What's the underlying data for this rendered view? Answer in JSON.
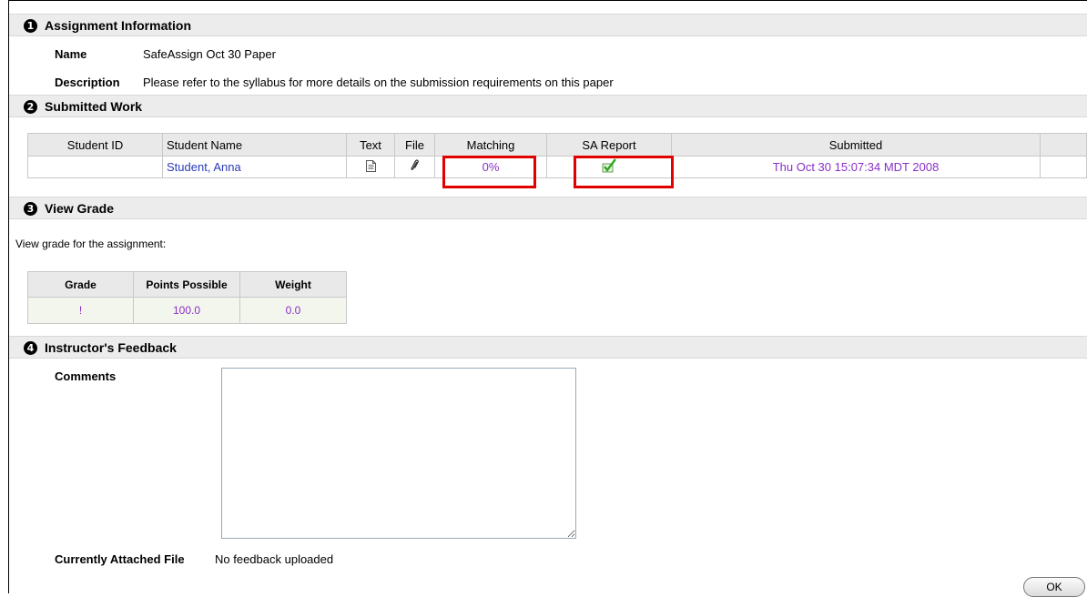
{
  "sections": {
    "assignment": {
      "number": "1",
      "title": "Assignment Information",
      "name_label": "Name",
      "name_value": "SafeAssign Oct 30 Paper",
      "description_label": "Description",
      "description_value": "Please refer to the syllabus for more details on the submission requirements on this paper"
    },
    "submitted": {
      "number": "2",
      "title": "Submitted Work",
      "columns": [
        "Student ID",
        "Student Name",
        "Text",
        "File",
        "Matching",
        "SA Report",
        "Submitted",
        ""
      ],
      "row": {
        "student_id": "",
        "student_name": "Student, Anna",
        "text_icon": "document-icon",
        "file_icon": "paperclip-icon",
        "matching": "0%",
        "sa_report_icon": "green-checkmark-icon",
        "submitted": "Thu Oct 30 15:07:34 MDT 2008"
      }
    },
    "grade": {
      "number": "3",
      "title": "View Grade",
      "intro": "View grade for the assignment:",
      "columns": [
        "Grade",
        "Points Possible",
        "Weight"
      ],
      "values": [
        "!",
        "100.0",
        "0.0"
      ]
    },
    "feedback": {
      "number": "4",
      "title": "Instructor's Feedback",
      "comments_label": "Comments",
      "comments_value": "",
      "attached_label": "Currently Attached File",
      "attached_value": "No feedback uploaded"
    }
  },
  "buttons": {
    "ok_label": "OK"
  },
  "colors": {
    "link": "#2a3ab8",
    "value_purple": "#8b2fc9",
    "highlight_box": "#e00000",
    "header_bg": "#ececec"
  }
}
